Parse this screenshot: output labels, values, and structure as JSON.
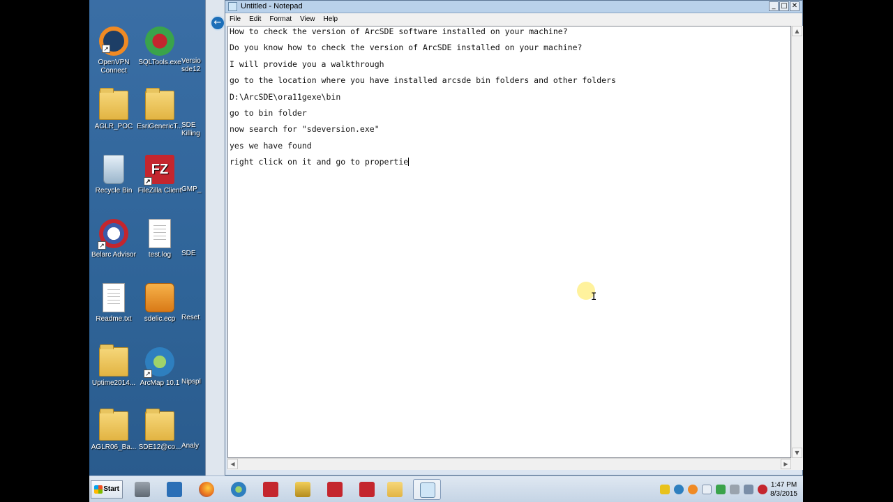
{
  "desktop": {
    "icons": [
      {
        "label": "OpenVPN Connect",
        "kind": "app",
        "color": "#f08a24"
      },
      {
        "label": "SQLTools.exe",
        "kind": "app",
        "color": "#3aa34b"
      },
      {
        "label": "AGLR_POC",
        "kind": "folder"
      },
      {
        "label": "EsriGenericT...",
        "kind": "folder"
      },
      {
        "label": "Recycle Bin",
        "kind": "bin"
      },
      {
        "label": "FileZilla Client",
        "kind": "app",
        "color": "#c4262e"
      },
      {
        "label": "Belarc Advisor",
        "kind": "app",
        "color": "#3b5ba8"
      },
      {
        "label": "test.log",
        "kind": "doc"
      },
      {
        "label": "Readme.txt",
        "kind": "doc"
      },
      {
        "label": "sdelic.ecp",
        "kind": "app",
        "color": "#e8962a"
      },
      {
        "label": "Uptime2014...",
        "kind": "folder"
      },
      {
        "label": "ArcMap 10.1",
        "kind": "app",
        "color": "#2e7fbf"
      },
      {
        "label": "AGLR06_Ba...",
        "kind": "folder"
      },
      {
        "label": "SDE12@co...",
        "kind": "folder"
      }
    ],
    "partial_icons": [
      "Versio sde12",
      "SDE Killing",
      "GMP_",
      "SDE",
      "Reset",
      "Nipspl",
      "Analy"
    ]
  },
  "notepad": {
    "title": "Untitled - Notepad",
    "menu": [
      "File",
      "Edit",
      "Format",
      "View",
      "Help"
    ],
    "lines": [
      "How to check the version of ArcSDE software installed on your machine?",
      "Do you know how to check the version of ArcSDE installed on your machine?",
      "I will provide you a walkthrough",
      "go to the location where you have installed arcsde bin folders and other folders",
      "D:\\ArcSDE\\ora11gexe\\bin",
      "go to bin folder",
      "now search for \"sdeversion.exe\"",
      "yes we have found",
      "right click on it and go to propertie"
    ]
  },
  "taskbar": {
    "start_label": "Start",
    "clock_time": "1:47 PM",
    "clock_date": "8/3/2015"
  }
}
